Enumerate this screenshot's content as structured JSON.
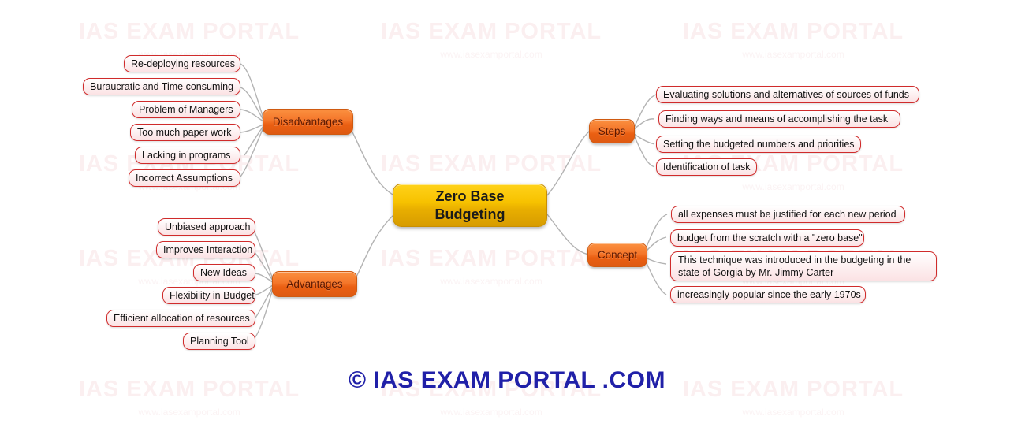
{
  "title": "Zero Base Budgeting Mind Map",
  "colors": {
    "root_fill": "#f7c200",
    "root_text": "#1a1a1a",
    "branch_fill": "#ea5f12",
    "branch_text": "#5c1800",
    "leaf_fill": "#fdeff0",
    "leaf_border": "#d02b2b",
    "leaf_text": "#111111",
    "connector": "#b3b3b3",
    "footer_text": "#2020a8",
    "watermark": "#fbeff0",
    "background": "#ffffff"
  },
  "root": {
    "line1": "Zero Base",
    "line2": "Budgeting"
  },
  "branches": [
    {
      "label": "Disadvantages",
      "side": "left",
      "leaves": [
        "Re-deploying resources",
        "Buraucratic and Time consuming",
        "Problem of Managers",
        "Too much paper work",
        "Lacking in programs",
        "Incorrect Assumptions"
      ]
    },
    {
      "label": "Advantages",
      "side": "left",
      "leaves": [
        "Unbiased approach",
        "Improves Interaction",
        "New Ideas",
        "Flexibility in Budget",
        "Efficient allocation of resources",
        "Planning Tool"
      ]
    },
    {
      "label": "Steps",
      "side": "right",
      "leaves": [
        "Evaluating  solutions and  alternatives of sources of funds",
        "Finding ways and means of accomplishing the task",
        "Setting the budgeted numbers and priorities",
        "Identification of  task"
      ]
    },
    {
      "label": "Concept",
      "side": "right",
      "leaves": [
        "all expenses must be justified for each new period",
        "budget from the scratch with a \"zero base\"",
        "This technique was introduced in the budgeting in the state of Gorgia by  Mr. Jimmy Carter",
        "increasingly popular since the early 1970s"
      ]
    }
  ],
  "footer": {
    "text": "© IAS EXAM PORTAL .COM"
  },
  "watermark": {
    "main": "IAS EXAM PORTAL",
    "sub": "www.iasexamportal.com"
  }
}
